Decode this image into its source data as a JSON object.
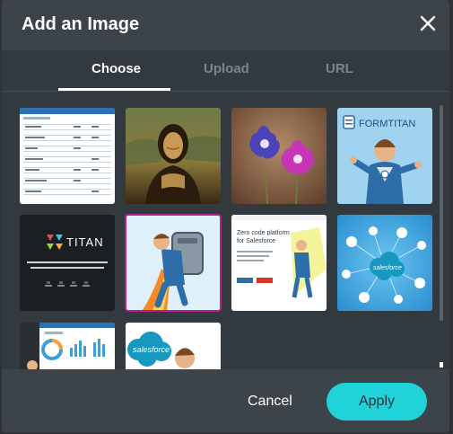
{
  "dialog": {
    "title": "Add an Image"
  },
  "tabs": [
    {
      "label": "Choose",
      "active": true
    },
    {
      "label": "Upload",
      "active": false
    },
    {
      "label": "URL",
      "active": false
    }
  ],
  "thumbnails": [
    {
      "name": "spreadsheet-screenshot"
    },
    {
      "name": "mona-lisa-painting"
    },
    {
      "name": "purple-flowers-photo"
    },
    {
      "name": "formtitan-mascot",
      "text": "FORMTITAN"
    },
    {
      "name": "titan-dark-banner",
      "text": "TITAN"
    },
    {
      "name": "jetpack-mascot",
      "selected": true
    },
    {
      "name": "no-code-platform-ad",
      "text_lines": [
        "Zero code platform",
        "for Salesforce"
      ]
    },
    {
      "name": "salesforce-network",
      "text": "salesforce"
    },
    {
      "name": "dashboard-screenshot"
    },
    {
      "name": "salesforce-mascot",
      "text": "salesforce"
    }
  ],
  "footer": {
    "cancel_label": "Cancel",
    "apply_label": "Apply"
  },
  "colors": {
    "accent": "#1fd3d9",
    "selection": "#b4238c",
    "header_bg": "#3c4349",
    "body_bg": "#333a3f"
  }
}
